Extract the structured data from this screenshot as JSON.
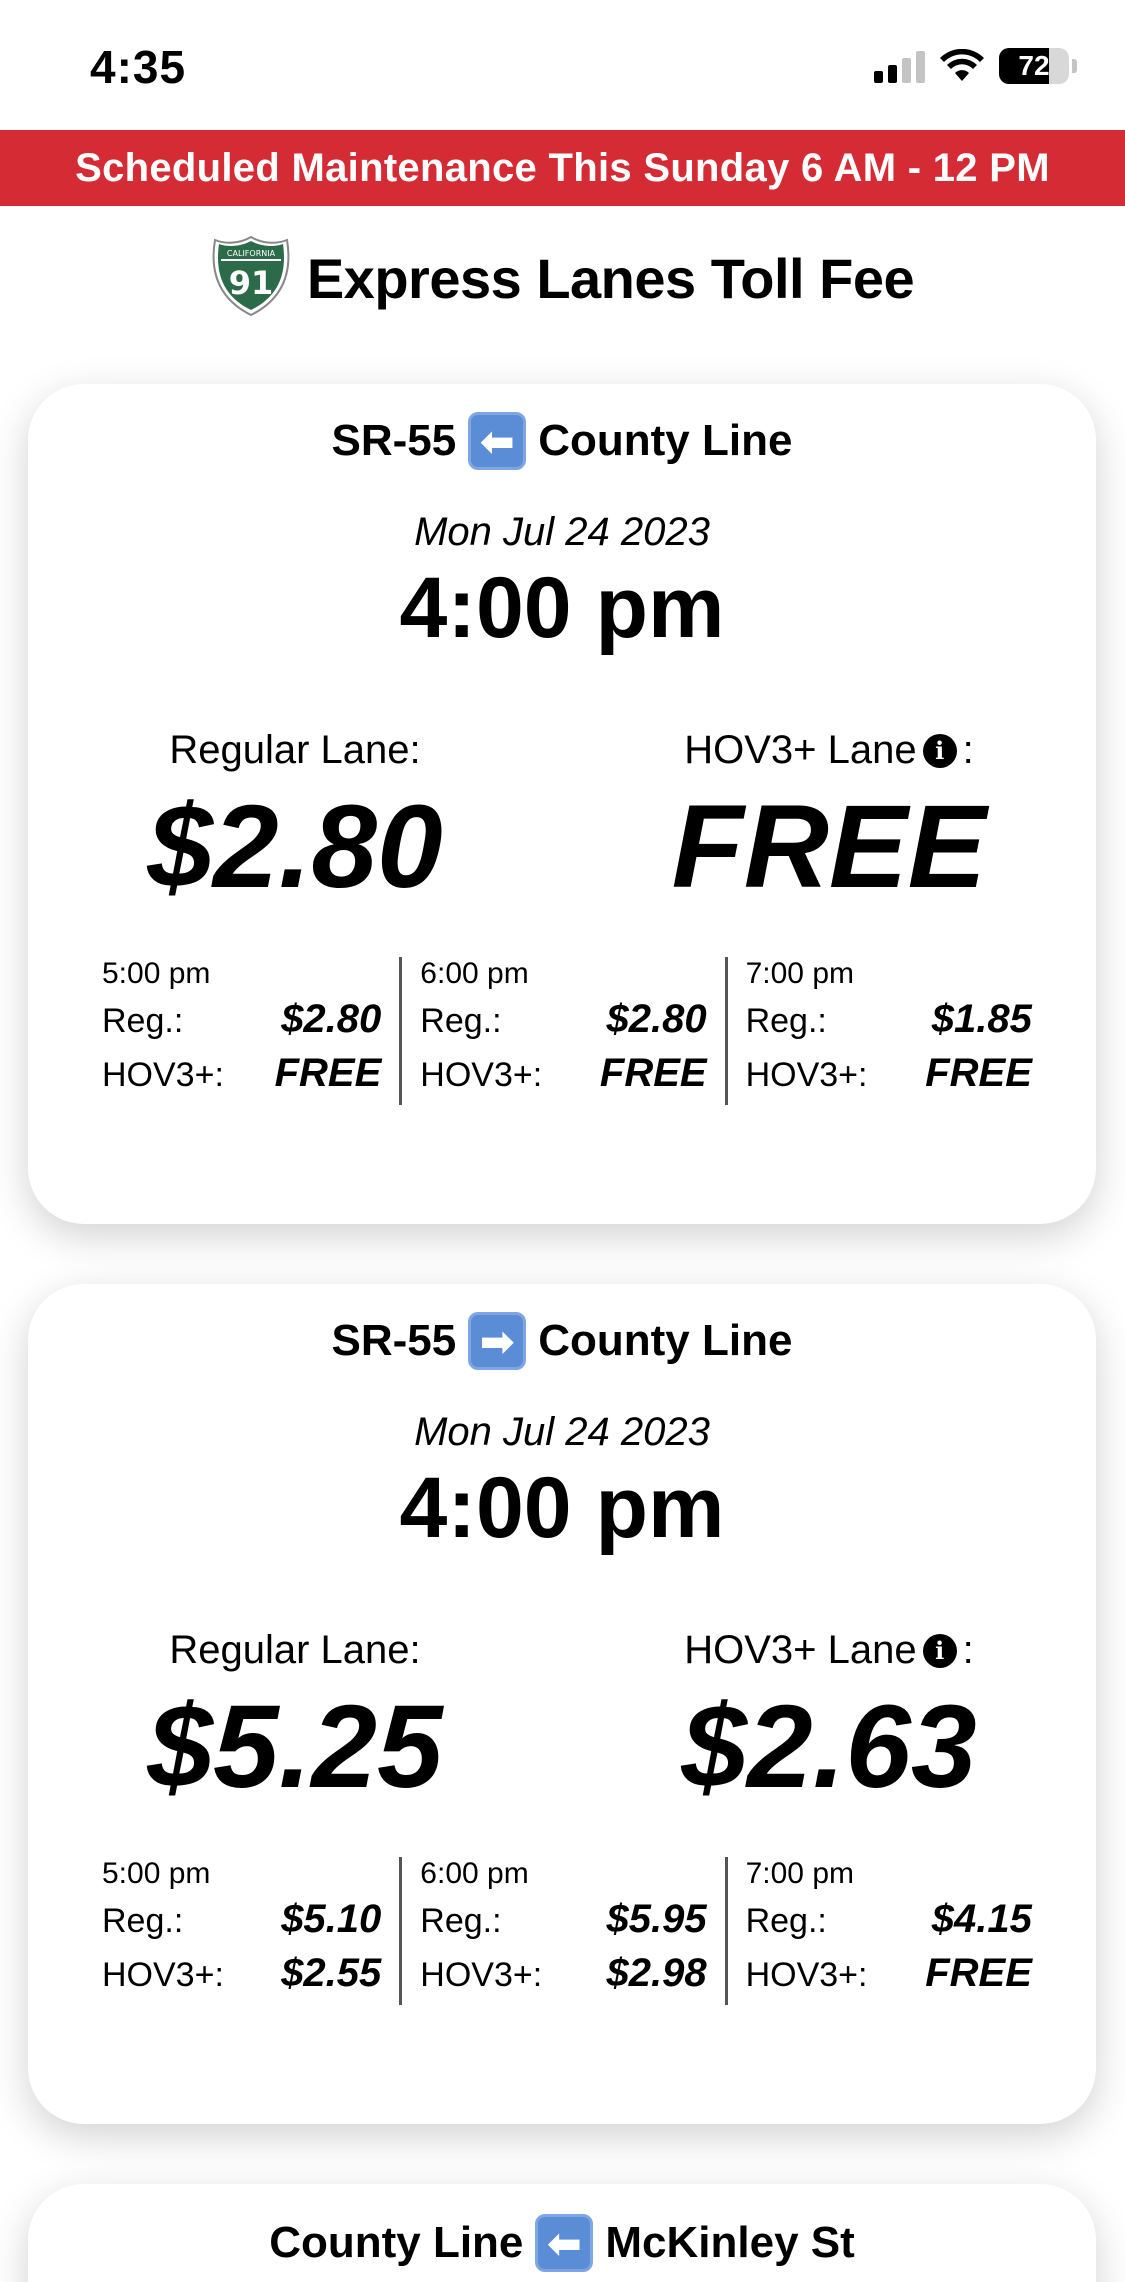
{
  "status_bar": {
    "time": "4:35",
    "battery": "72"
  },
  "banner": {
    "text": "Scheduled Maintenance This Sunday 6 AM - 12 PM"
  },
  "header": {
    "shield_top": "CALIFORNIA",
    "shield_number": "91",
    "title": "Express Lanes Toll Fee"
  },
  "colors": {
    "banner": "#d52b35",
    "shield": "#2b6b4a",
    "arrow_box": "#5b8dd6"
  },
  "cards": [
    {
      "route_from": "SR-55",
      "direction_icon": "left-arrow-icon",
      "arrow_glyph": "⬅",
      "route_to": "County Line",
      "date": "Mon Jul 24 2023",
      "time": "4:00 pm",
      "regular_label": "Regular Lane:",
      "regular_price": "$2.80",
      "hov_label": "HOV3+ Lane",
      "hov_suffix": ":",
      "hov_price": "FREE",
      "forecast": [
        {
          "time": "5:00 pm",
          "reg_label": "Reg.:",
          "reg": "$2.80",
          "hov_label": "HOV3+:",
          "hov": "FREE"
        },
        {
          "time": "6:00 pm",
          "reg_label": "Reg.:",
          "reg": "$2.80",
          "hov_label": "HOV3+:",
          "hov": "FREE"
        },
        {
          "time": "7:00 pm",
          "reg_label": "Reg.:",
          "reg": "$1.85",
          "hov_label": "HOV3+:",
          "hov": "FREE"
        }
      ]
    },
    {
      "route_from": "SR-55",
      "direction_icon": "right-arrow-icon",
      "arrow_glyph": "➡",
      "route_to": "County Line",
      "date": "Mon Jul 24 2023",
      "time": "4:00 pm",
      "regular_label": "Regular Lane:",
      "regular_price": "$5.25",
      "hov_label": "HOV3+ Lane",
      "hov_suffix": ":",
      "hov_price": "$2.63",
      "forecast": [
        {
          "time": "5:00 pm",
          "reg_label": "Reg.:",
          "reg": "$5.10",
          "hov_label": "HOV3+:",
          "hov": "$2.55"
        },
        {
          "time": "6:00 pm",
          "reg_label": "Reg.:",
          "reg": "$5.95",
          "hov_label": "HOV3+:",
          "hov": "$2.98"
        },
        {
          "time": "7:00 pm",
          "reg_label": "Reg.:",
          "reg": "$4.15",
          "hov_label": "HOV3+:",
          "hov": "FREE"
        }
      ]
    },
    {
      "route_from": "County Line",
      "direction_icon": "left-arrow-icon",
      "arrow_glyph": "⬅",
      "route_to": "McKinley St"
    }
  ]
}
